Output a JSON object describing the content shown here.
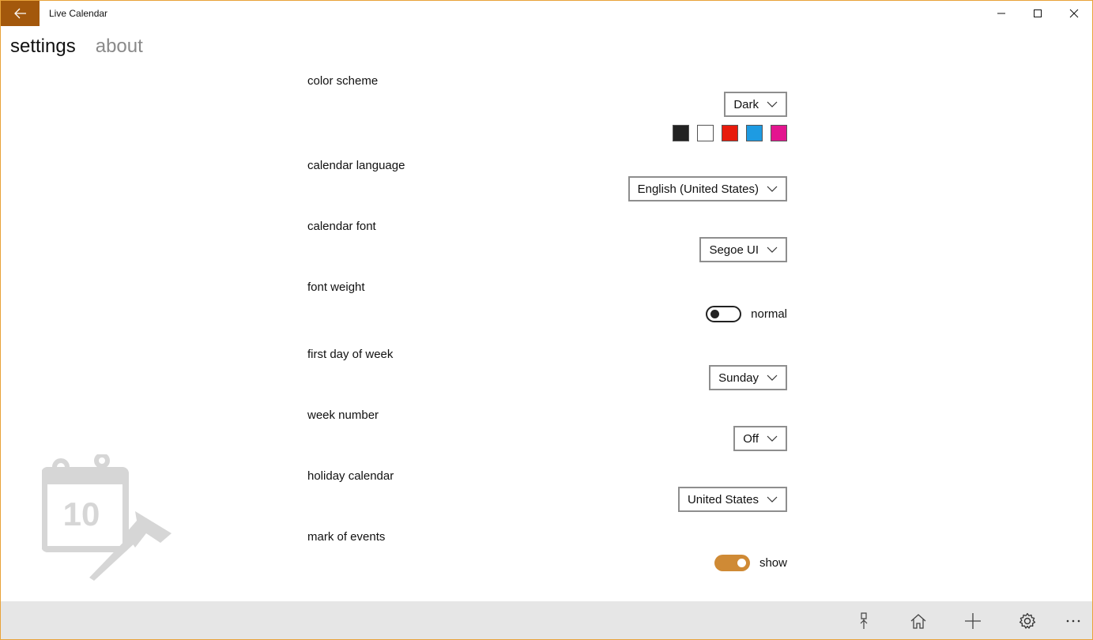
{
  "window": {
    "title": "Live Calendar"
  },
  "pivot": {
    "tabs": [
      "settings",
      "about"
    ]
  },
  "settings": {
    "color_scheme": {
      "label": "color scheme",
      "value": "Dark",
      "swatches": [
        "#222222",
        "#ffffff",
        "#e81b0c",
        "#1e9be2",
        "#e3158f"
      ]
    },
    "calendar_language": {
      "label": "calendar language",
      "value": "English (United States)"
    },
    "calendar_font": {
      "label": "calendar font",
      "value": "Segoe UI"
    },
    "font_weight": {
      "label": "font weight",
      "state_text": "normal",
      "on": false
    },
    "first_day_of_week": {
      "label": "first day of week",
      "value": "Sunday"
    },
    "week_number": {
      "label": "week number",
      "value": "Off"
    },
    "holiday_calendar": {
      "label": "holiday calendar",
      "value": "United States"
    },
    "mark_of_events": {
      "label": "mark of events",
      "state_text": "show",
      "on": true
    }
  },
  "logo": {
    "number": "10"
  },
  "colors": {
    "accent": "#a3580c",
    "toggle_on": "#cf8a35",
    "command_bar": "#e6e6e6"
  },
  "command_bar": {
    "icons": [
      "pin-icon",
      "home-icon",
      "add-icon",
      "gear-icon",
      "more-icon"
    ]
  }
}
